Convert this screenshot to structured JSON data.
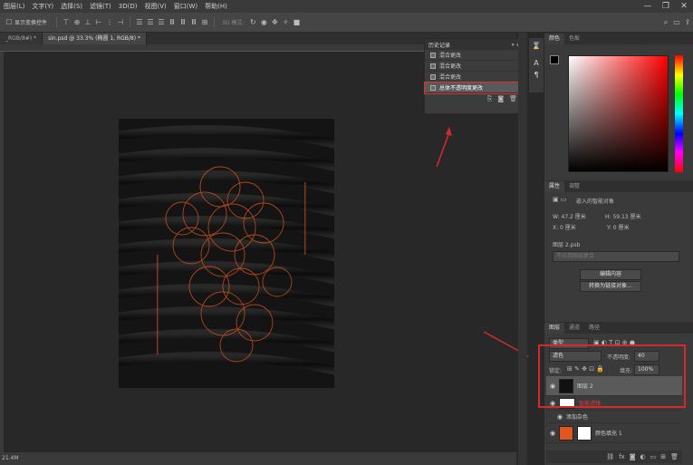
{
  "menubar": {
    "items": [
      "图层(L)",
      "文字(Y)",
      "选择(S)",
      "滤镜(T)",
      "3D(D)",
      "视图(V)",
      "窗口(W)",
      "帮助(H)"
    ]
  },
  "optionsbar": {
    "transform_label": "显示变换控件",
    "mode_label": "3D 模式:"
  },
  "doc_tabs": [
    "_RGB/8#) *",
    "sin.psd @ 33.3% (椭圆 1, RGB/8) *"
  ],
  "status": {
    "size": "21.4M"
  },
  "history_panel": {
    "title": "历史记录",
    "items": [
      {
        "label": "混合更改",
        "selected": false
      },
      {
        "label": "混合更改",
        "selected": false
      },
      {
        "label": "混合更改",
        "selected": false
      },
      {
        "label": "总体不透明度更改",
        "selected": true
      }
    ]
  },
  "color_panel": {
    "tabs": [
      "颜色",
      "色板"
    ]
  },
  "properties_panel": {
    "tabs": [
      "属性",
      "调整"
    ],
    "type_label": "嵌入的智能对象",
    "w_label": "W: 47.2 厘米",
    "h_label": "H: 59.13 厘米",
    "x_label": "X: 0 厘米",
    "y_label": "Y: 0 厘米",
    "file_name": "图层 2.psb",
    "comp_placeholder": "不应用图层复合",
    "edit_button": "编辑内容",
    "convert_button": "转换为链接对象..."
  },
  "layers_panel": {
    "tabs": [
      "图层",
      "通道",
      "路径"
    ],
    "filter_kind": "类型",
    "blend_mode": "滤色",
    "opacity_label": "不透明度:",
    "opacity_value": "40",
    "lock_label": "锁定:",
    "fill_label": "填充:",
    "fill_value": "100%",
    "layers": [
      {
        "name": "图层 2"
      },
      {
        "name": "智能滤镜"
      },
      {
        "name": "添加杂色"
      },
      {
        "name": "颜色填充 1"
      }
    ]
  },
  "colors": {
    "highlight": "#d62a2a",
    "accent_orange": "#e0561e"
  }
}
